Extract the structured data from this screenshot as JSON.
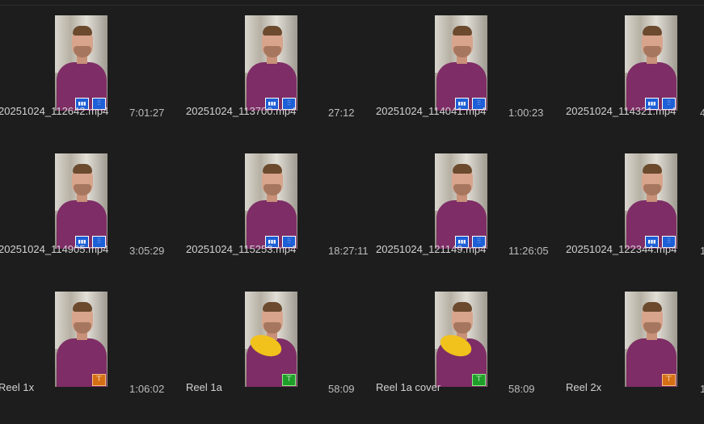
{
  "bin": {
    "items": [
      {
        "name": "20251024_112642.mp4",
        "duration": "7:01:27",
        "badges": [
          "video",
          "audio"
        ],
        "thumb": "person"
      },
      {
        "name": "20251024_113700.mp4",
        "duration": "27:12",
        "badges": [
          "video",
          "audio"
        ],
        "thumb": "person"
      },
      {
        "name": "20251024_114041.mp4",
        "duration": "1:00:23",
        "badges": [
          "video",
          "audio"
        ],
        "thumb": "person"
      },
      {
        "name": "20251024_114321.mp4",
        "duration": "4",
        "badges": [
          "video",
          "audio"
        ],
        "thumb": "person"
      },
      {
        "name": "20251024_114905.mp4",
        "duration": "3:05:29",
        "badges": [
          "video",
          "audio"
        ],
        "thumb": "person"
      },
      {
        "name": "20251024_115253.mp4",
        "duration": "18:27:11",
        "badges": [
          "video",
          "audio"
        ],
        "thumb": "person"
      },
      {
        "name": "20251024_121149.mp4",
        "duration": "11:26:05",
        "badges": [
          "video",
          "audio"
        ],
        "thumb": "person"
      },
      {
        "name": "20251024_122344.mp4",
        "duration": "1",
        "badges": [
          "video",
          "audio"
        ],
        "thumb": "person"
      },
      {
        "name": "Reel 1x",
        "duration": "1:06:02",
        "badges": [
          "sequence-orange"
        ],
        "thumb": "person"
      },
      {
        "name": "Reel 1a",
        "duration": "58:09",
        "badges": [
          "sequence-green"
        ],
        "thumb": "banana"
      },
      {
        "name": "Reel 1a cover",
        "duration": "58:09",
        "badges": [
          "sequence-green"
        ],
        "thumb": "banana"
      },
      {
        "name": "Reel 2x",
        "duration": "1",
        "badges": [
          "sequence-orange"
        ],
        "thumb": "person"
      }
    ]
  },
  "icons": {
    "video": "film-strip-icon",
    "audio": "audio-waveform-icon",
    "sequence-orange": "sequence-icon",
    "sequence-green": "sequence-icon"
  },
  "colors": {
    "background": "#1d1d1d",
    "badge_blue": "#1d5fd6",
    "badge_orange": "#d46f14",
    "badge_green": "#1f9e2a"
  }
}
